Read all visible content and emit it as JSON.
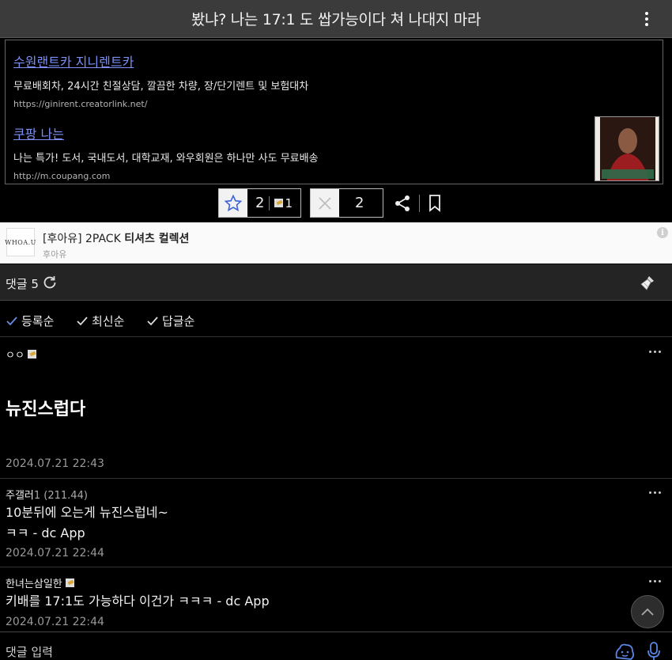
{
  "header": {
    "title": "봤냐? 나는 17:1 도 쌉가능이다 쳐 나대지 마라",
    "menu_icon": "kebab-menu-icon"
  },
  "ads": [
    {
      "link": "수원랜트카 지니렌트카",
      "desc": "무료배회차, 24시간 친절상담, 깔끔한 차량, 장/단기렌트 및 보험대차",
      "url": "https://ginirent.creatorlink.net/"
    },
    {
      "link": "쿠팡 나는",
      "desc": "나는 특가! 도서, 국내도서, 대학교재, 와우회원은 하나만 사도 무료배송",
      "url": "http://m.coupang.com"
    }
  ],
  "vote": {
    "up_count": "2",
    "fixed_count": "1",
    "down_count": "2"
  },
  "sponsor": {
    "logo_text": "WHOA.U",
    "title_prefix": "[후아유] 2PACK ",
    "title_bold": "티셔츠 컬렉션",
    "subtitle": "후아유",
    "info": "i"
  },
  "comments_header": {
    "label": "댓글 5"
  },
  "sort": [
    {
      "label": "등록순",
      "active": true
    },
    {
      "label": "최신순",
      "active": false
    },
    {
      "label": "답글순",
      "active": false
    }
  ],
  "comments": [
    {
      "author": "ㅇㅇ",
      "ip": "",
      "text_lines": [
        "뉴진스럽다"
      ],
      "date": "2024.07.21 22:43"
    },
    {
      "author": "주갤러",
      "ip": "1 (211.44)",
      "text_lines": [
        "10분뒤에 오는게 뉴진스럽네~",
        "ㅋㅋ - dc App"
      ],
      "date": "2024.07.21 22:44"
    },
    {
      "author": "한녀는삼일한",
      "ip": "",
      "text_lines": [
        "키배를 17:1도 가능하다 이건가 ㅋㅋㅋ - dc App"
      ],
      "date": "2024.07.21 22:44"
    }
  ],
  "input": {
    "placeholder": "댓글 입력"
  },
  "colors": {
    "link": "#7b8ff5",
    "topbar": "#3b3b3b",
    "accent_check": "#6b8fe8"
  }
}
